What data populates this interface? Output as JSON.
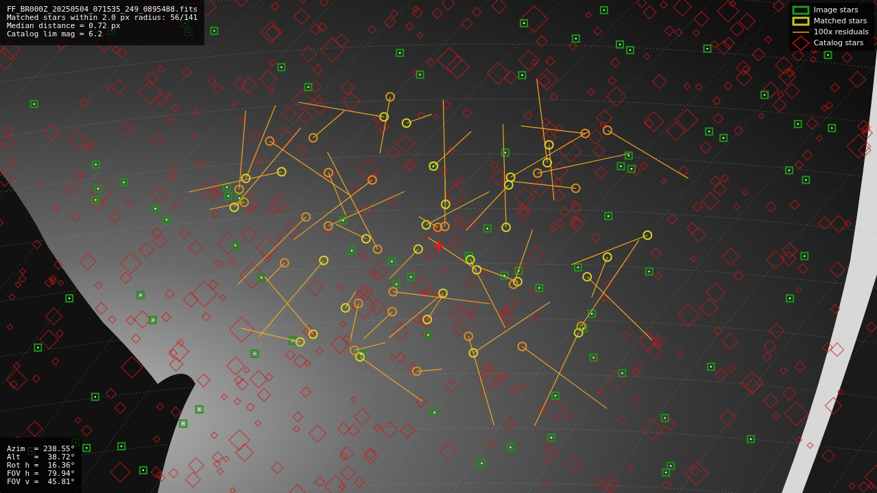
{
  "info_panel": {
    "lines": [
      "FF_BR000Z_20250504_071535_249_0895488.fits",
      "Matched stars within 2.0 px radius: 56/141",
      "Median distance = 0.72 px",
      "Catalog lim mag = 6.2"
    ]
  },
  "legend": [
    {
      "kind": "image",
      "label": "Image stars"
    },
    {
      "kind": "matched",
      "label": "Matched stars"
    },
    {
      "kind": "residual",
      "label": "100x residuals"
    },
    {
      "kind": "catalog",
      "label": "Catalog stars"
    }
  ],
  "pointing_panel": {
    "lines": [
      "Azim  = 238.55°",
      "Alt   =  38.72°",
      "Rot h =  16.36°",
      "FOV h =  79.94°",
      "FOV v =  45.81°"
    ]
  }
}
